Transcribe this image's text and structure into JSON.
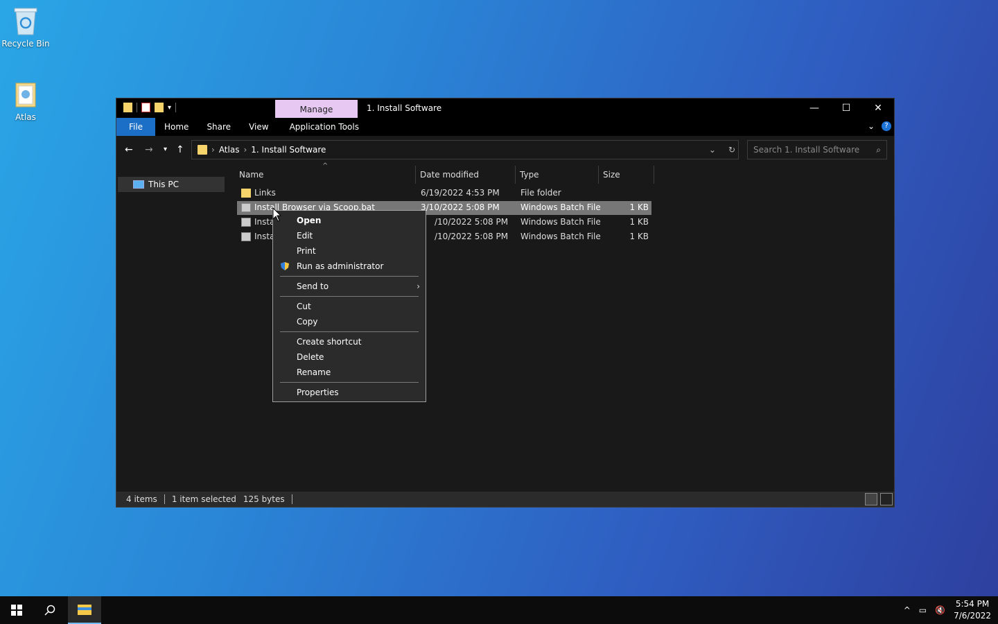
{
  "desktop": {
    "icons": [
      {
        "label": "Recycle Bin",
        "icon": "recycle-bin-icon"
      },
      {
        "label": "Atlas",
        "icon": "folder-icon"
      }
    ]
  },
  "window": {
    "manage_tab": "Manage",
    "title": "1. Install Software",
    "ribbon_tabs": [
      "File",
      "Home",
      "Share",
      "View",
      "Application Tools"
    ],
    "help_label": "?",
    "breadcrumb": [
      "Atlas",
      "1. Install Software"
    ],
    "search_placeholder": "Search 1. Install Software",
    "nav_pane": {
      "items": [
        {
          "label": "This PC"
        }
      ]
    },
    "columns": [
      "Name",
      "Date modified",
      "Type",
      "Size"
    ],
    "files": [
      {
        "name": "Links",
        "date": "6/19/2022 4:53 PM",
        "type": "File folder",
        "size": "",
        "icon": "folder-icon",
        "selected": false
      },
      {
        "name": "Install Browser via Scoop.bat",
        "date": "3/10/2022 5:08 PM",
        "type": "Windows Batch File",
        "size": "1 KB",
        "icon": "batch-file-icon",
        "selected": true
      },
      {
        "name": "Instal",
        "date": "/10/2022 5:08 PM",
        "type": "Windows Batch File",
        "size": "1 KB",
        "icon": "batch-file-icon",
        "selected": false
      },
      {
        "name": "Instal",
        "date": "/10/2022 5:08 PM",
        "type": "Windows Batch File",
        "size": "1 KB",
        "icon": "batch-file-icon",
        "selected": false
      }
    ],
    "status": {
      "items": "4 items",
      "selected": "1 item selected",
      "bytes": "125 bytes"
    }
  },
  "context_menu": {
    "groups": [
      [
        "Open",
        "Edit",
        "Print",
        "Run as administrator"
      ],
      [
        "Send to"
      ],
      [
        "Cut",
        "Copy"
      ],
      [
        "Create shortcut",
        "Delete",
        "Rename"
      ],
      [
        "Properties"
      ]
    ]
  },
  "taskbar": {
    "time": "5:54 PM",
    "date": "7/6/2022"
  },
  "colors": {
    "accent": "#1b6fc7",
    "manage_tab": "#e6c8f3",
    "selection": "#777777",
    "folder": "#f7d46b"
  }
}
